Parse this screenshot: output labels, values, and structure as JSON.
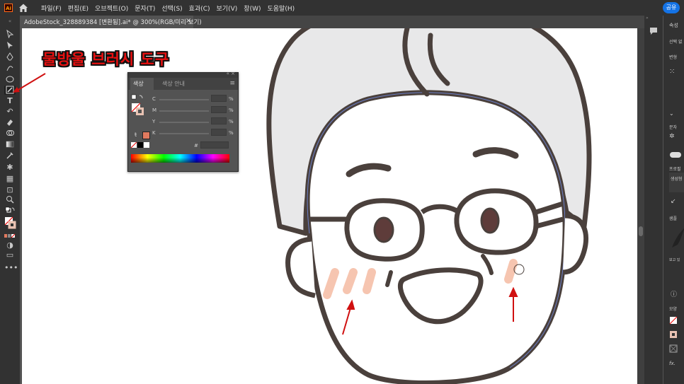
{
  "app": {
    "logo": "Ai",
    "share_label": "공유"
  },
  "menu": [
    "파일(F)",
    "편집(E)",
    "오브젝트(O)",
    "문자(T)",
    "선택(S)",
    "효과(C)",
    "보기(V)",
    "창(W)",
    "도움말(H)"
  ],
  "document_tab": {
    "title": "AdobeStock_328889384 [변환됨].ai* @ 300%(RGB/미리 보기)",
    "close": "×"
  },
  "annotation": {
    "text": "물방울 브러시 도구",
    "color": "#e81010"
  },
  "color_panel": {
    "tab_color": "색상",
    "tab_guide": "색상 안내",
    "channels": [
      "C",
      "M",
      "Y",
      "K"
    ],
    "percent": "%",
    "hex_symbol": "#"
  },
  "right_panel": {
    "properties_title": "속성",
    "labels": [
      "선택 없",
      "변형",
      "문자",
      "프로필",
      "생성형",
      "샘플",
      "보고 있",
      "모양",
      "fx."
    ]
  },
  "colors": {
    "accent": "#1473e6",
    "outline": "#4a403c",
    "hair": "#e8e8e9",
    "blush": "#f6c5b0",
    "eye": "#5e3c3a",
    "arrow": "#d01010"
  },
  "icons": [
    "home-icon",
    "selection-tool-icon",
    "direct-selection-tool-icon",
    "pen-tool-icon",
    "curvature-tool-icon",
    "ellipse-tool-icon",
    "blob-brush-tool-icon",
    "type-tool-icon",
    "rotate-tool-icon",
    "eraser-tool-icon",
    "shape-builder-icon",
    "gradient-tool-icon",
    "eyedropper-tool-icon",
    "symbol-sprayer-icon",
    "zoom-tool-icon",
    "fill-stroke-icon",
    "comment-icon",
    "more-tools-icon"
  ]
}
